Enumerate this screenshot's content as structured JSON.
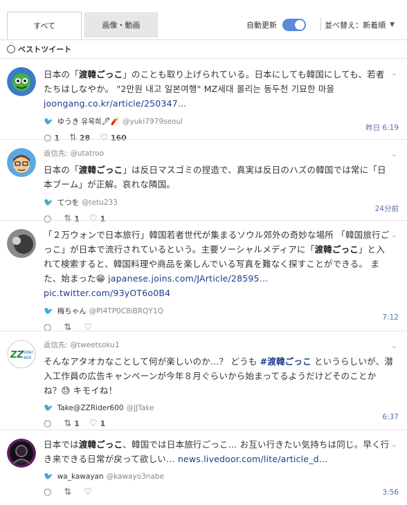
{
  "tabs": {
    "all": "すべて",
    "media": "画像・動画"
  },
  "auto_update": {
    "label": "自動更新"
  },
  "sort": {
    "label": "並べ替え：新着順"
  },
  "best": {
    "label": "ベストツイート"
  },
  "tweets": [
    {
      "reply_to": "",
      "text_a": "日本の「",
      "bold_a": "渡韓ごっこ",
      "text_b": "」のことも取り上げられている。日本にしても韓国にしても、若者たちはしなやか。 \"2만원 내고 일본여행\" MZ세대 몰리는 동두천 기묘한 마을",
      "link": "joongang.co.kr/article/250347…",
      "name": "ゆうき 유욱희🖋🧨",
      "handle": "@yuki7979seoul",
      "replies": "1",
      "retweets": "28",
      "likes": "160",
      "time": "昨日 6:19"
    },
    {
      "reply_to": "@utatroo",
      "reply_prefix": "返信先:",
      "text_a": "日本の「",
      "bold_a": "渡韓ごっこ",
      "text_b": "」は反日マスゴミの捏造で、真実は反日のハズの韓国では常に「日本ブーム」が正解。哀れな隣国。",
      "name": "てつを",
      "handle": "@tetu233",
      "replies": "",
      "retweets": "1",
      "likes": "1",
      "time": "24分前"
    },
    {
      "text_a": "「２万ウォンで日本旅行」韓国若者世代が集まるソウル郊外の奇妙な場所 「韓国旅行ごっこ」が日本で流行されているという。主要ソーシャルメディアに「",
      "bold_a": "渡韓ごっこ",
      "text_b": "」と入れて検索すると、韓国料理や商品を楽しんでいる写真を難なく探すことができる。 また、始まった😁",
      "link": "japanese.joins.com/JArticle/28595…",
      "link2": "pic.twitter.com/93yOT6o0B4",
      "name": "梅ちゃん",
      "handle": "@PI4TP0C8iBRQY1Q",
      "time": "7:12"
    },
    {
      "reply_prefix": "返信先:",
      "reply_to": "@tweetsoku1",
      "text_a": "そんなアタオカなことして何が楽しいのか...？ どうも ",
      "bold_a": "#渡韓ごっこ",
      "text_b": " というらしいが、潜入工作員の広告キャンペーンが今年８月ぐらいから始まってるようだけどそのことかね？😓 キモイね！",
      "name": "Take@ZZRider600",
      "handle": "@JJTake",
      "retweets": "1",
      "likes": "1",
      "time": "6:37"
    },
    {
      "text_a": "日本では",
      "bold_a": "渡韓ごっこ",
      "text_b": "、韓国では日本旅行ごっこ… お互い行きたい気持ちは同じ。早く行き来できる日常が戻って欲しい… ",
      "link": "news.livedoor.com/lite/article_d…",
      "name": "wa_kawayan",
      "handle": "@kawayo3nabe",
      "time": "3:56"
    }
  ],
  "icons": [
    "search-icon",
    "twitter-bird-icon",
    "reply-icon",
    "retweet-icon",
    "like-icon",
    "chevron-down-icon"
  ]
}
